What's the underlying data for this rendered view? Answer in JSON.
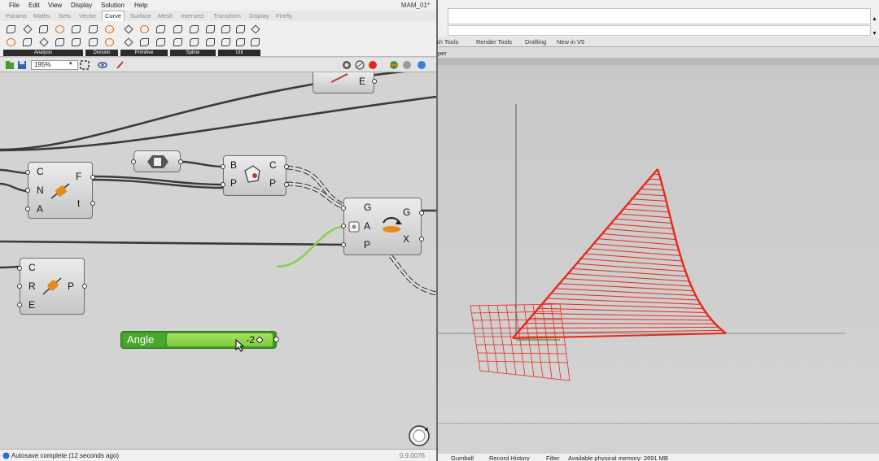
{
  "gh": {
    "menus": [
      "File",
      "Edit",
      "View",
      "Display",
      "Solution",
      "Help"
    ],
    "title": "MAM_01*",
    "tabs": [
      "Params",
      "Maths",
      "Sets",
      "Vector",
      "Curve",
      "Surface",
      "Mesh",
      "Intersect",
      "Transform",
      "Display",
      "Firefly"
    ],
    "active_tab": "Curve",
    "ribbon_groups": [
      "Analysis",
      "Division",
      "Primitive",
      "Spline",
      "Util"
    ],
    "zoom": "195%",
    "status": "Autosave complete (12 seconds ago)",
    "version": "0.9.0076"
  },
  "components": {
    "top": {
      "in_e": "E"
    },
    "frame": {
      "in_c": "C",
      "in_n": "N",
      "in_a": "A",
      "out_f": "F",
      "out_t": "t"
    },
    "bp": {
      "in_b": "B",
      "in_p": "P",
      "out_c": "C",
      "out_p": "P"
    },
    "rotate": {
      "in_g": "G",
      "in_a": "A",
      "in_p": "P",
      "out_g": "G",
      "out_x": "X"
    },
    "crp": {
      "in_c": "C",
      "in_r": "R",
      "in_e": "E",
      "out_p": "P"
    }
  },
  "slider": {
    "name": "Angle",
    "value": "-2"
  },
  "rhino": {
    "tabs": [
      "sh Tools",
      "Render Tools",
      "Drafting",
      "New in V5"
    ],
    "viewport_title": "per",
    "status": [
      "Gumball",
      "Record History",
      "Filter",
      "Available physical memory: 2691 MB"
    ]
  },
  "colors": {
    "geometry": "#e8281a",
    "slider": "#4aa82f",
    "orange_icon": "#e88a1a"
  }
}
